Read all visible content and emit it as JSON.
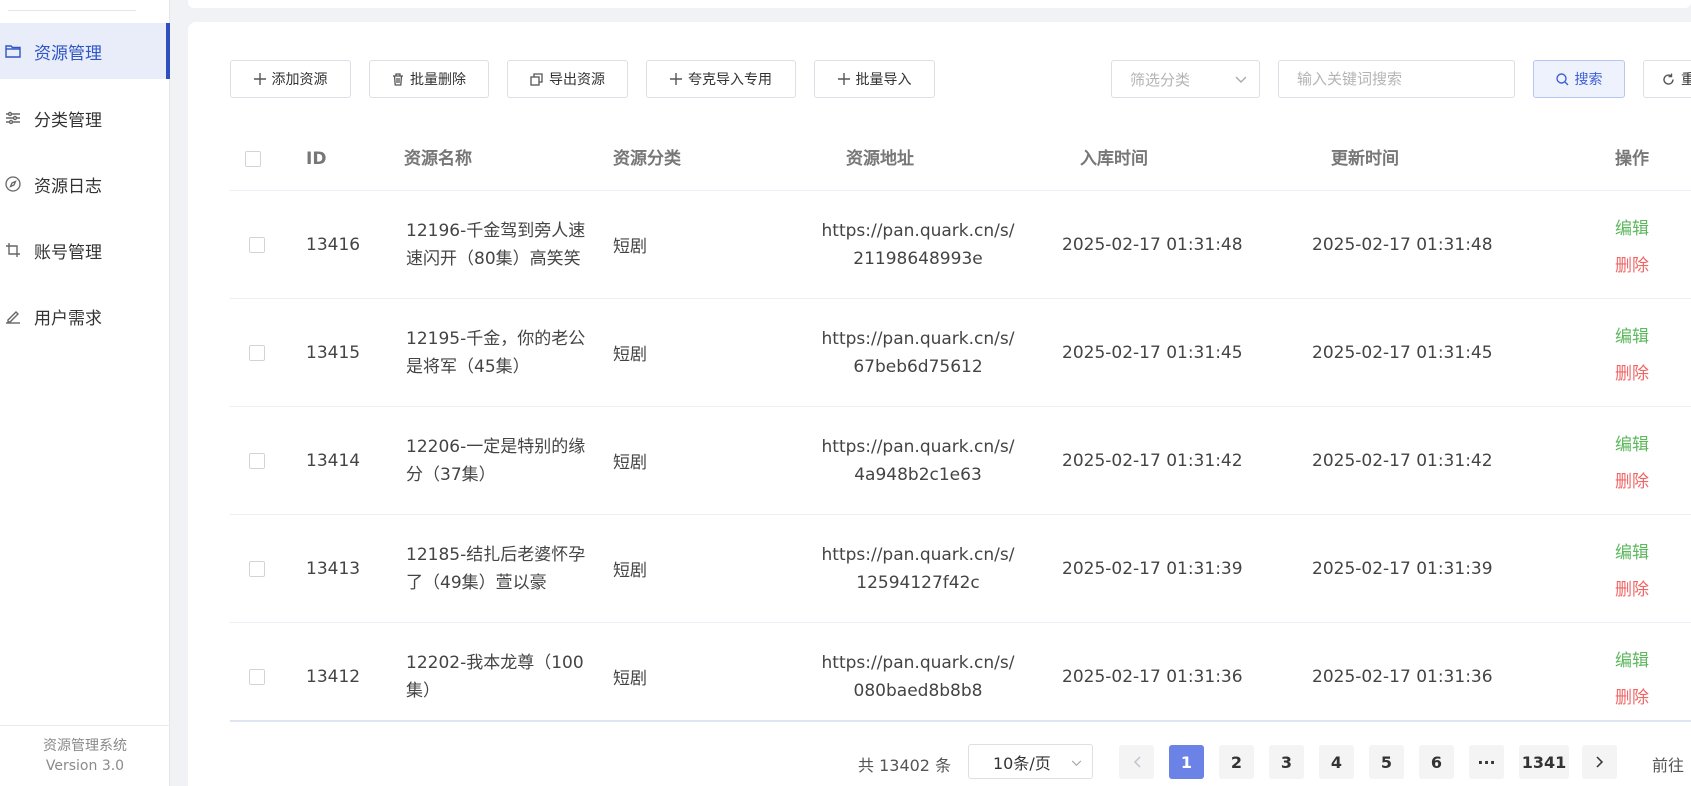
{
  "sidebar": {
    "items": [
      {
        "label": "资源管理",
        "icon": "folder-icon",
        "active": true
      },
      {
        "label": "分类管理",
        "icon": "sliders-icon",
        "active": false
      },
      {
        "label": "资源日志",
        "icon": "compass-icon",
        "active": false
      },
      {
        "label": "账号管理",
        "icon": "crop-icon",
        "active": false
      },
      {
        "label": "用户需求",
        "icon": "edit-icon",
        "active": false
      }
    ],
    "footer": {
      "title": "资源管理系统",
      "version": "Version 3.0"
    }
  },
  "toolbar": {
    "add_label": "添加资源",
    "batch_delete_label": "批量删除",
    "export_label": "导出资源",
    "quark_import_label": "夸克导入专用",
    "batch_import_label": "批量导入",
    "filter_placeholder": "筛选分类",
    "search_placeholder": "输入关键词搜索",
    "search_label": "搜索",
    "reset_label": "重"
  },
  "table": {
    "headers": {
      "id": "ID",
      "name": "资源名称",
      "category": "资源分类",
      "url": "资源地址",
      "created": "入库时间",
      "updated": "更新时间",
      "ops": "操作"
    },
    "edit_label": "编辑",
    "delete_label": "删除",
    "rows": [
      {
        "id": "13416",
        "name": "12196-千金驾到旁人速速闪开（80集）高笑笑",
        "category": "短剧",
        "url": "https://pan.quark.cn/s/21198648993e",
        "created": "2025-02-17 01:31:48",
        "updated": "2025-02-17 01:31:48"
      },
      {
        "id": "13415",
        "name": "12195-千金，你的老公是将军（45集）",
        "category": "短剧",
        "url": "https://pan.quark.cn/s/67beb6d75612",
        "created": "2025-02-17 01:31:45",
        "updated": "2025-02-17 01:31:45"
      },
      {
        "id": "13414",
        "name": "12206-一定是特别的缘分（37集）",
        "category": "短剧",
        "url": "https://pan.quark.cn/s/4a948b2c1e63",
        "created": "2025-02-17 01:31:42",
        "updated": "2025-02-17 01:31:42"
      },
      {
        "id": "13413",
        "name": "12185-结扎后老婆怀孕了（49集）萱以豪",
        "category": "短剧",
        "url": "https://pan.quark.cn/s/12594127f42c",
        "created": "2025-02-17 01:31:39",
        "updated": "2025-02-17 01:31:39"
      },
      {
        "id": "13412",
        "name": "12202-我本龙尊（100集）",
        "category": "短剧",
        "url": "https://pan.quark.cn/s/080baed8b8b8",
        "created": "2025-02-17 01:31:36",
        "updated": "2025-02-17 01:31:36"
      }
    ]
  },
  "pagination": {
    "total_text": "共 13402 条",
    "page_size": "10条/页",
    "pages": [
      "1",
      "2",
      "3",
      "4",
      "5",
      "6",
      "···",
      "1341"
    ],
    "current": "1",
    "goto_label": "前往"
  },
  "colors": {
    "accent": "#2f4fbf",
    "active_page": "#6b82e6",
    "edit": "#5cb85c",
    "delete": "#f06565"
  }
}
